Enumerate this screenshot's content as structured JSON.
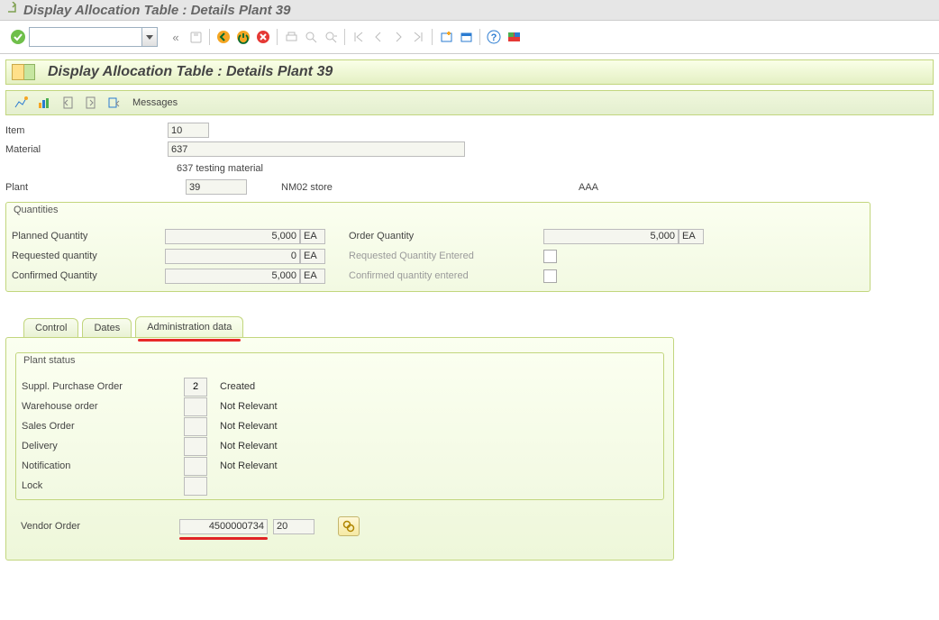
{
  "window": {
    "title": "Display Allocation Table : Details Plant 39"
  },
  "page": {
    "title": "Display Allocation Table : Details Plant 39"
  },
  "app_toolbar": {
    "messages": "Messages"
  },
  "header": {
    "item_label": "Item",
    "item_value": "10",
    "material_label": "Material",
    "material_value": "637",
    "material_desc": "637 testing material",
    "plant_label": "Plant",
    "plant_value": "39",
    "plant_desc": "NM02 store",
    "plant_extra": "AAA"
  },
  "quantities": {
    "title": "Quantities",
    "uom": "EA",
    "planned_label": "Planned Quantity",
    "planned_value": "5,000",
    "requested_label": "Requested quantity",
    "requested_value": "0",
    "confirmed_label": "Confirmed Quantity",
    "confirmed_value": "5,000",
    "order_label": "Order Quantity",
    "order_value": "5,000",
    "req_entered_label": "Requested Quantity Entered",
    "conf_entered_label": "Confirmed quantity entered"
  },
  "tabs": {
    "control": "Control",
    "dates": "Dates",
    "admin": "Administration data"
  },
  "plant_status": {
    "title": "Plant status",
    "spo_label": "Suppl. Purchase Order",
    "spo_val": "2",
    "spo_txt": "Created",
    "wh_label": "Warehouse order",
    "wh_val": "",
    "wh_txt": "Not Relevant",
    "so_label": "Sales Order",
    "so_val": "",
    "so_txt": "Not Relevant",
    "dl_label": "Delivery",
    "dl_val": "",
    "dl_txt": "Not Relevant",
    "nt_label": "Notification",
    "nt_val": "",
    "nt_txt": "Not Relevant",
    "lk_label": "Lock",
    "lk_val": ""
  },
  "vendor": {
    "label": "Vendor Order",
    "value": "4500000734",
    "item": "20"
  }
}
